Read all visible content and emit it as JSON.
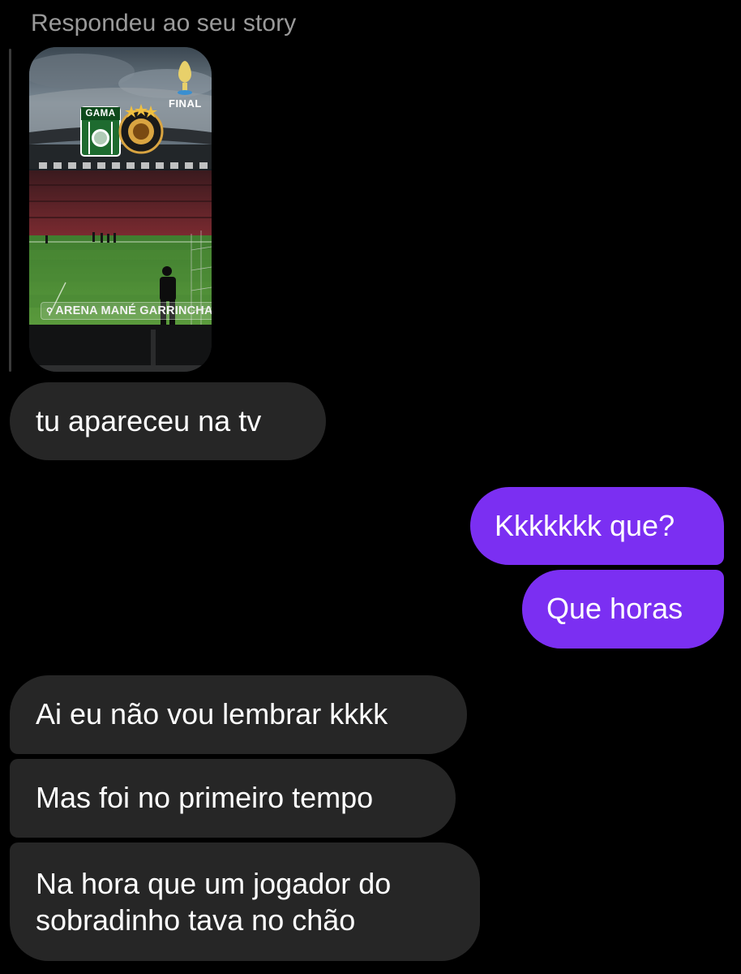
{
  "reply_header": "Respondeu ao seu story",
  "story": {
    "location": "ARENA MANÉ GARRINCHA",
    "badge_text": "FINAL",
    "team_left": "GAMA"
  },
  "messages": [
    {
      "direction": "incoming",
      "text": "tu apareceu na tv"
    },
    {
      "direction": "outgoing",
      "text": "Kkkkkkk que?"
    },
    {
      "direction": "outgoing",
      "text": "Que horas"
    },
    {
      "direction": "incoming",
      "text": "Ai eu não vou lembrar kkkk"
    },
    {
      "direction": "incoming",
      "text": "Mas foi no primeiro tempo"
    },
    {
      "direction": "incoming",
      "lines": [
        "Na hora que um jogador do",
        "sobradinho tava no chão"
      ]
    }
  ],
  "colors": {
    "background": "#000000",
    "incoming_bubble": "#262626",
    "outgoing_bubble": "#7b2ff2",
    "reply_text": "#9a9a9a"
  }
}
